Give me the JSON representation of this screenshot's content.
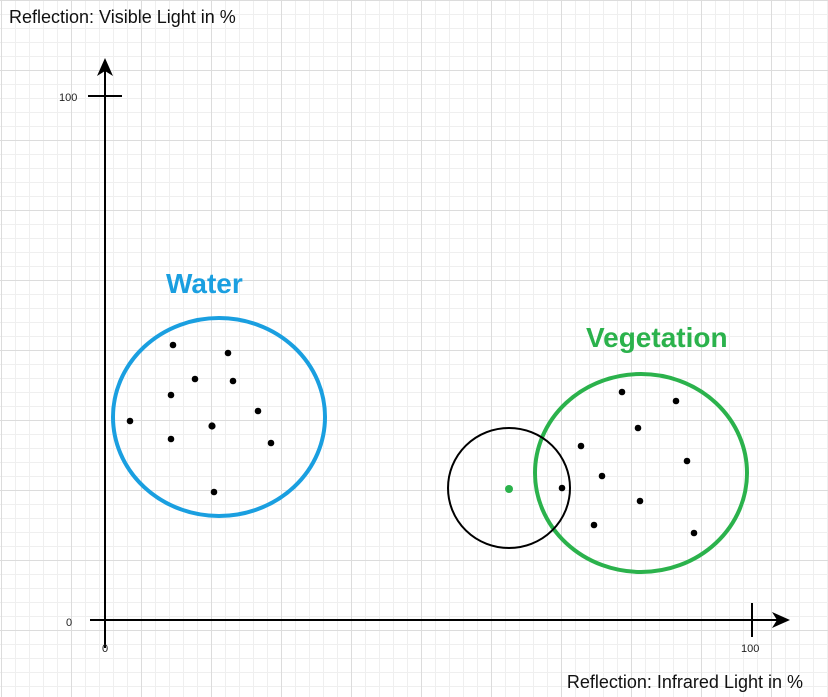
{
  "axes": {
    "y_title": "Reflection: Visible Light in %",
    "x_title": "Reflection: Infrared Light in %",
    "y_tick_max": "100",
    "y_tick_min": "0",
    "x_tick_min": "0",
    "x_tick_max": "100",
    "x_range": [
      0,
      100
    ],
    "y_range": [
      0,
      100
    ]
  },
  "clusters": {
    "water": {
      "label": "Water",
      "color": "#1a9fe0"
    },
    "vegetation": {
      "label": "Vegetation",
      "color": "#2bb24c"
    }
  },
  "query": {
    "color": "#2bb24c",
    "circle_color": "#000000"
  },
  "colors": {
    "point": "#000000",
    "axis": "#000000"
  }
}
